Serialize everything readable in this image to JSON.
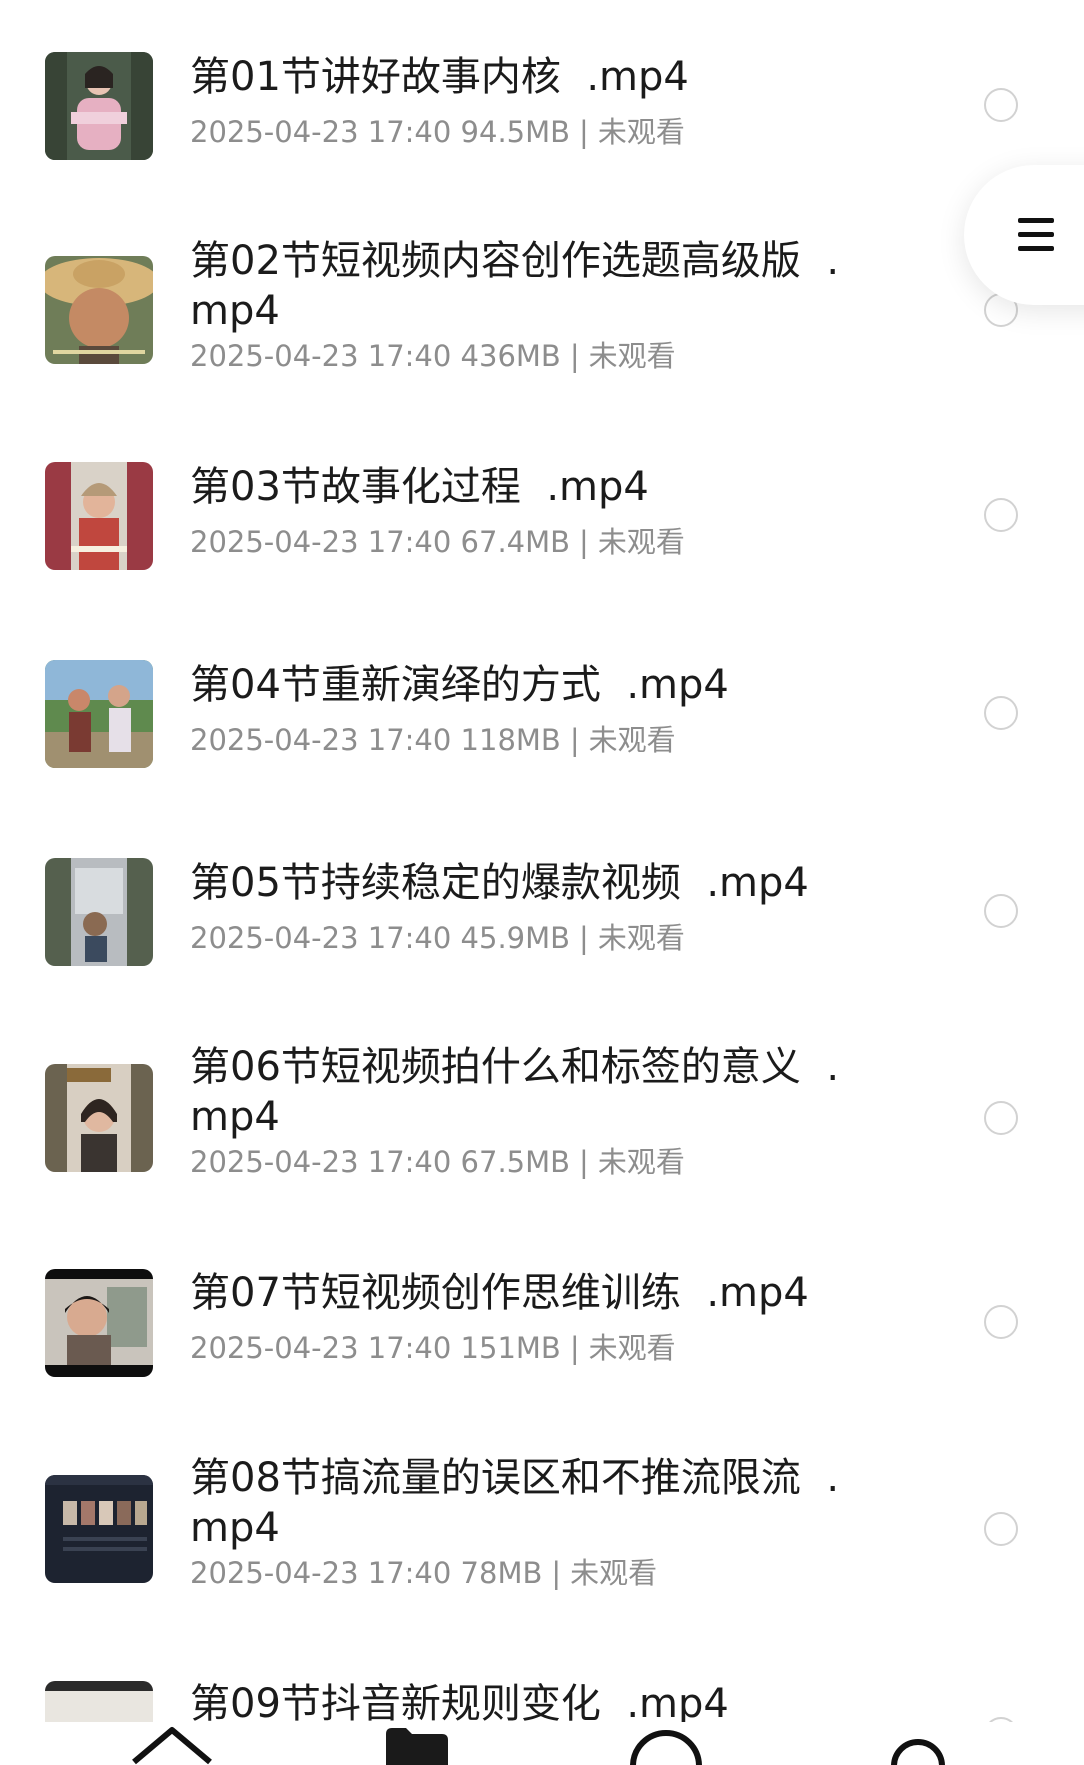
{
  "files": [
    {
      "title": "第01节讲好故事内核  .mp4",
      "date": "2025-04-23 17:40",
      "size": "94.5MB",
      "status": "未观看"
    },
    {
      "title": "第02节短视频内容创作选题高级版  .\nmp4",
      "date": "2025-04-23 17:40",
      "size": "436MB",
      "status": "未观看"
    },
    {
      "title": "第03节故事化过程  .mp4",
      "date": "2025-04-23 17:40",
      "size": "67.4MB",
      "status": "未观看"
    },
    {
      "title": "第04节重新演绎的方式  .mp4",
      "date": "2025-04-23 17:40",
      "size": "118MB",
      "status": "未观看"
    },
    {
      "title": "第05节持续稳定的爆款视频  .mp4",
      "date": "2025-04-23 17:40",
      "size": "45.9MB",
      "status": "未观看"
    },
    {
      "title": "第06节短视频拍什么和标签的意义  .\nmp4",
      "date": "2025-04-23 17:40",
      "size": "67.5MB",
      "status": "未观看"
    },
    {
      "title": "第07节短视频创作思维训练  .mp4",
      "date": "2025-04-23 17:40",
      "size": "151MB",
      "status": "未观看"
    },
    {
      "title": "第08节搞流量的误区和不推流限流  .\nmp4",
      "date": "2025-04-23 17:40",
      "size": "78MB",
      "status": "未观看"
    },
    {
      "title": "第09节抖音新规则变化  .mp4",
      "date": "",
      "size": "",
      "status": ""
    }
  ],
  "meta_separator": "|",
  "icons": {
    "thumbnail": "video-thumbnail",
    "select": "radio-circle-icon",
    "menu": "hamburger-menu-icon",
    "nav": [
      "home-icon",
      "folder-icon",
      "circle-icon",
      "profile-icon"
    ]
  },
  "colors": {
    "title": "#1b1b1b",
    "meta": "#8d8d8d",
    "radio_border": "#d2d2d2",
    "background": "#ffffff"
  }
}
